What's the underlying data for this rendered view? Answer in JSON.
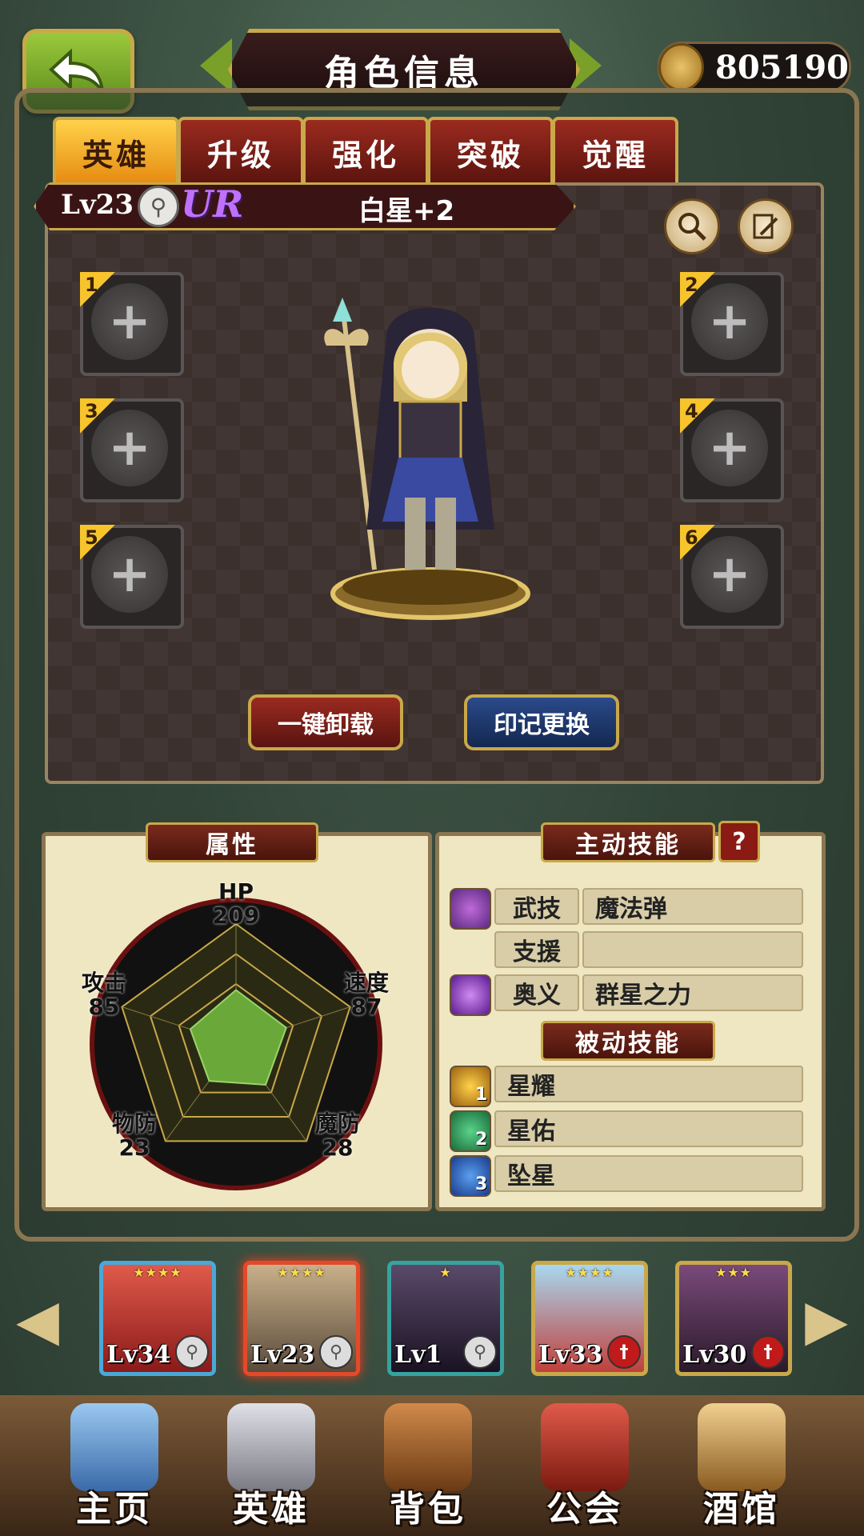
{
  "header": {
    "title": "角色信息",
    "currency_value": "805190"
  },
  "tabs": [
    {
      "label": "英雄",
      "active": true
    },
    {
      "label": "升级",
      "active": false
    },
    {
      "label": "强化",
      "active": false
    },
    {
      "label": "突破",
      "active": false
    },
    {
      "label": "觉醒",
      "active": false
    }
  ],
  "hero": {
    "level": "Lv23",
    "rarity": "UR",
    "star_rank": "白星+2"
  },
  "slots": [
    "1",
    "2",
    "3",
    "4",
    "5",
    "6"
  ],
  "actions": {
    "unequip_all": "一键卸载",
    "change_mark": "印记更换"
  },
  "attributes": {
    "title": "属性",
    "hp_label": "HP",
    "hp": "209",
    "attack_label": "攻击",
    "attack": "85",
    "speed_label": "速度",
    "speed": "87",
    "pdef_label": "物防",
    "pdef": "23",
    "mdef_label": "魔防",
    "mdef": "28",
    "radar_levels": [
      0.45,
      0.44,
      0.42,
      0.38,
      0.4
    ]
  },
  "skills": {
    "active_title": "主动技能",
    "help": "?",
    "active": [
      {
        "tag": "武技",
        "name": "魔法弹",
        "icon": "staff-skill-icon"
      },
      {
        "tag": "支援",
        "name": "",
        "icon": ""
      },
      {
        "tag": "奥义",
        "name": "群星之力",
        "icon": "purple-orb-icon"
      }
    ],
    "passive_title": "被动技能",
    "passive": [
      {
        "num": "1",
        "name": "星耀",
        "color": "#e3a21c"
      },
      {
        "num": "2",
        "name": "星佑",
        "color": "#3c9a5c"
      },
      {
        "num": "3",
        "name": "坠星",
        "color": "#2e6fcf"
      }
    ]
  },
  "roster": [
    {
      "level": "Lv34",
      "stars": "★★★★",
      "badge": "key",
      "border": "#4aa8d8",
      "bg": "#c93a3a"
    },
    {
      "level": "Lv23",
      "stars": "★★★★",
      "badge": "key",
      "border": "#e24a2a",
      "bg": "#b49a70"
    },
    {
      "level": "Lv1",
      "stars": "★",
      "badge": "key",
      "border": "#36a3a0",
      "bg": "#3a2a44"
    },
    {
      "level": "Lv33",
      "stars": "★★★★",
      "badge": "sword",
      "border": "#c9a84a",
      "bg": "#7ab8d8"
    },
    {
      "level": "Lv30",
      "stars": "★★★",
      "badge": "sword",
      "border": "#c9a84a",
      "bg": "#4a2a4a"
    }
  ],
  "nav": [
    {
      "label": "主页",
      "icon": "castle-icon",
      "color": "#6aa3d8"
    },
    {
      "label": "英雄",
      "icon": "helmet-icon",
      "color": "#b9b9c0"
    },
    {
      "label": "背包",
      "icon": "bag-icon",
      "color": "#b06a30"
    },
    {
      "label": "公会",
      "icon": "shield-icon",
      "color": "#c03a2a"
    },
    {
      "label": "酒馆",
      "icon": "beer-icon",
      "color": "#c08a40"
    }
  ]
}
